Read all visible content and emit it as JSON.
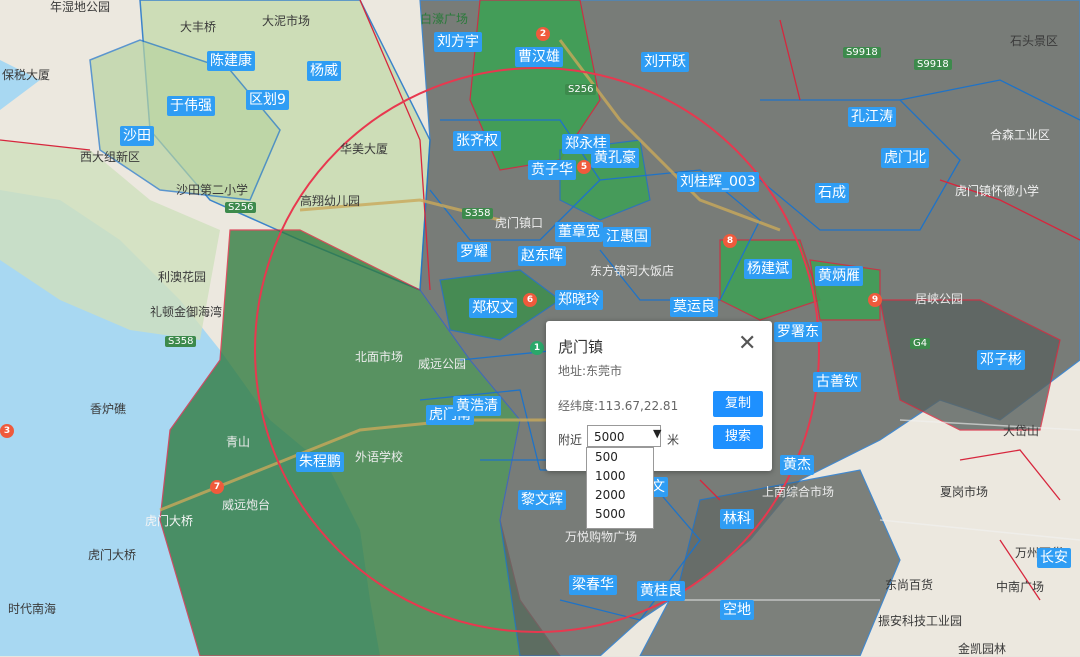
{
  "popup": {
    "title": "虎门镇",
    "close_glyph": "✕",
    "address": "地址:东莞市",
    "coordinates": "经纬度:113.67,22.81",
    "copy_button": "复制",
    "near_label": "附近",
    "radius_selected": "5000",
    "radius_options": [
      "500",
      "1000",
      "2000",
      "5000"
    ],
    "unit": "米",
    "search_button": "搜索"
  },
  "territory_labels": [
    "刘方宇",
    "曹汉雄",
    "刘开跃",
    "陈建康",
    "杨威",
    "区划9",
    "于伟强",
    "沙田",
    "张齐权",
    "郑永桂",
    "黄孔豪",
    "贲子华",
    "孔江涛",
    "虎门北",
    "刘桂辉_003",
    "石成",
    "罗耀",
    "赵东晖",
    "董章宽",
    "江惠国",
    "郑权文",
    "郑晓玲",
    "莫运良",
    "杨建斌",
    "黄炳雁",
    "罗署东",
    "古善钦",
    "邓子彬",
    "虎门南",
    "黄浩清",
    "朱程鹏",
    "黎文辉",
    "文",
    "黄杰",
    "林科",
    "梁春华",
    "黄桂良",
    "空地",
    "长安"
  ],
  "place_names": [
    "年湿地公园",
    "大丰桥",
    "大泥市场",
    "白濠广场",
    "保税大厦",
    "石头景区",
    "西大组新区",
    "沙田第二小学",
    "华美大厦",
    "高翔幼儿园",
    "虎门镇怀德小学",
    "合森工业区",
    "利澳花园",
    "礼顿金御海湾",
    "虎门镇口",
    "东方锦河大饭店",
    "居峡公园",
    "北面市场",
    "威远公园",
    "青山",
    "外语学校",
    "大岱山",
    "虎门大桥",
    "香炉礁",
    "威远炮台",
    "虎门大桥",
    "时代南海",
    "东尚百货",
    "中南广场",
    "振安科技工业园",
    "万州百货",
    "夏岗市场",
    "上南综合市场",
    "金凯园林",
    "万悦购物广场"
  ],
  "road_labels": [
    "S256",
    "S358",
    "S9918",
    "S9918",
    "S256",
    "S358",
    "G4"
  ],
  "markers": [
    "1",
    "2",
    "3",
    "5",
    "6",
    "7",
    "8",
    "9"
  ],
  "colors": {
    "territory_green": "#2f9a43",
    "territory_gray": "#636363",
    "territory_blue_border": "#1e73c8",
    "territory_red_border": "#d7263d",
    "label_bg": "#2f9df4",
    "button": "#1e90ff",
    "water": "#a8d8f2",
    "light_green_land": "#c9dcb2"
  }
}
